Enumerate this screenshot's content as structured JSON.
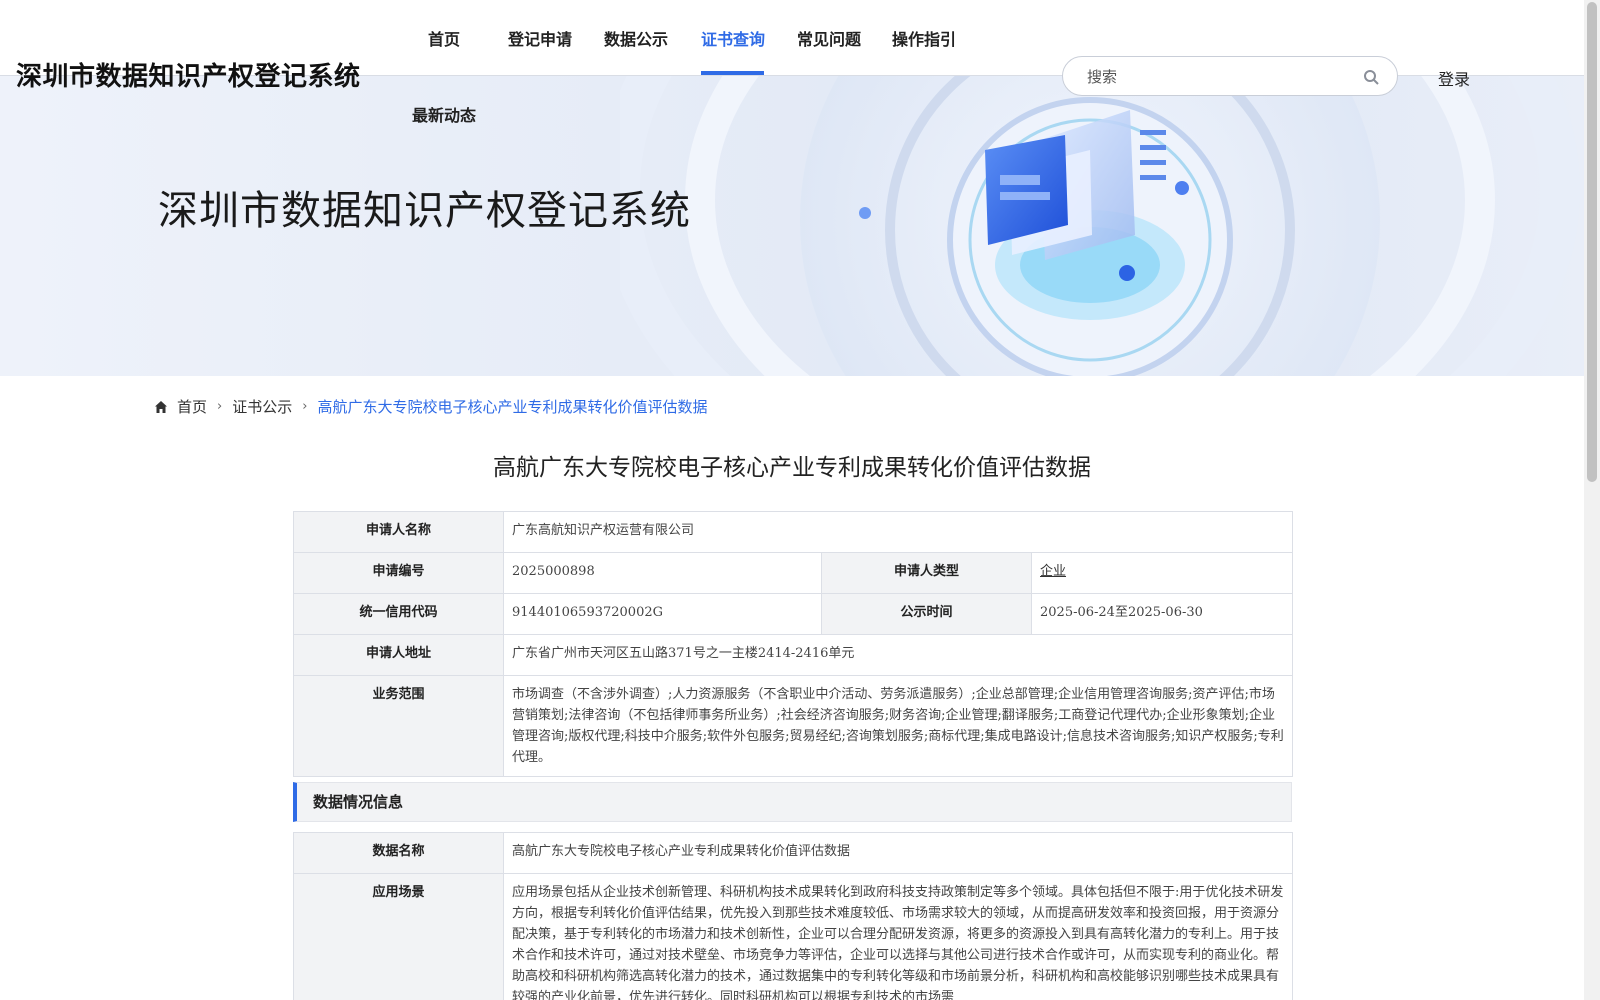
{
  "header": {
    "site_title": "深圳市数据知识产权登记系统",
    "nav": [
      {
        "label": "首页"
      },
      {
        "label": "登记申请"
      },
      {
        "label": "数据公示"
      },
      {
        "label": "证书查询",
        "active": true
      },
      {
        "label": "常见问题"
      },
      {
        "label": "操作指引"
      },
      {
        "label": "最新动态"
      }
    ],
    "search_placeholder": "搜索",
    "login_label": "登录",
    "accent_color": "#2f6be6"
  },
  "banner": {
    "heading": "深圳市数据知识产权登记系统"
  },
  "breadcrumb": {
    "home": "首页",
    "level1": "证书公示",
    "current": "高航广东大专院校电子核心产业专利成果转化价值评估数据"
  },
  "detail": {
    "title": "高航广东大专院校电子核心产业专利成果转化价值评估数据",
    "applicant": {
      "name_label": "申请人名称",
      "name_value": "广东高航知识产权运营有限公司",
      "number_label": "申请编号",
      "number_value": "2025000898",
      "type_label": "申请人类型",
      "type_value": "企业",
      "credit_label": "统一信用代码",
      "credit_value": "91440106593720002G",
      "publicity_label": "公示时间",
      "publicity_value": "2025-06-24至2025-06-30",
      "address_label": "申请人地址",
      "address_value": "广东省广州市天河区五山路371号之一主楼2414-2416单元",
      "scope_label": "业务范围",
      "scope_value": "市场调查（不含涉外调查）;人力资源服务（不含职业中介活动、劳务派遣服务）;企业总部管理;企业信用管理咨询服务;资产评估;市场营销策划;法律咨询（不包括律师事务所业务）;社会经济咨询服务;财务咨询;企业管理;翻译服务;工商登记代理代办;企业形象策划;企业管理咨询;版权代理;科技中介服务;软件外包服务;贸易经纪;咨询策划服务;商标代理;集成电路设计;信息技术咨询服务;知识产权服务;专利代理。"
    },
    "data_section": {
      "header": "数据情况信息",
      "name_label": "数据名称",
      "name_value": "高航广东大专院校电子核心产业专利成果转化价值评估数据",
      "scenario_label": "应用场景",
      "scenario_value": "应用场景包括从企业技术创新管理、科研机构技术成果转化到政府科技支持政策制定等多个领域。具体包括但不限于:用于优化技术研发方向，根据专利转化价值评估结果，优先投入到那些技术难度较低、市场需求较大的领域，从而提高研发效率和投资回报，用于资源分配决策，基于专利转化的市场潜力和技术创新性，企业可以合理分配研发资源，将更多的资源投入到具有高转化潜力的专利上。用于技术合作和技术许可，通过对技术壁垒、市场竞争力等评估，企业可以选择与其他公司进行技术合作或许可，从而实现专利的商业化。帮助高校和科研机构筛选高转化潜力的技术，通过数据集中的专利转化等级和市场前景分析，科研机构和高校能够识别哪些技术成果具有较强的产业化前景，优先进行转化。同时科研机构可以根据专利技术的市场需"
    }
  }
}
